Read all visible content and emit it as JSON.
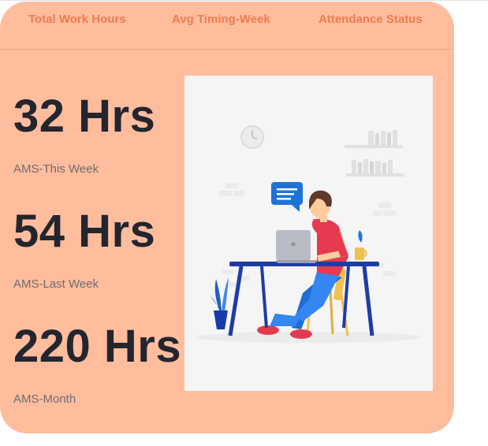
{
  "tabs": [
    {
      "label": "Total Work Hours"
    },
    {
      "label": "Avg Timing-Week"
    },
    {
      "label": "Attendance Status"
    }
  ],
  "stats": [
    {
      "value": "32 Hrs",
      "label": "AMS-This Week"
    },
    {
      "value": "54 Hrs",
      "label": "AMS-Last Week"
    },
    {
      "value": "220 Hrs",
      "label": "AMS-Month"
    }
  ],
  "colors": {
    "card_background": "#ffbd9e",
    "tab_text": "#ee7b4f",
    "value_text": "#23262e",
    "label_text": "#6f6c6c"
  },
  "illustration": {
    "icon": "person-working-at-laptop-illustration"
  }
}
